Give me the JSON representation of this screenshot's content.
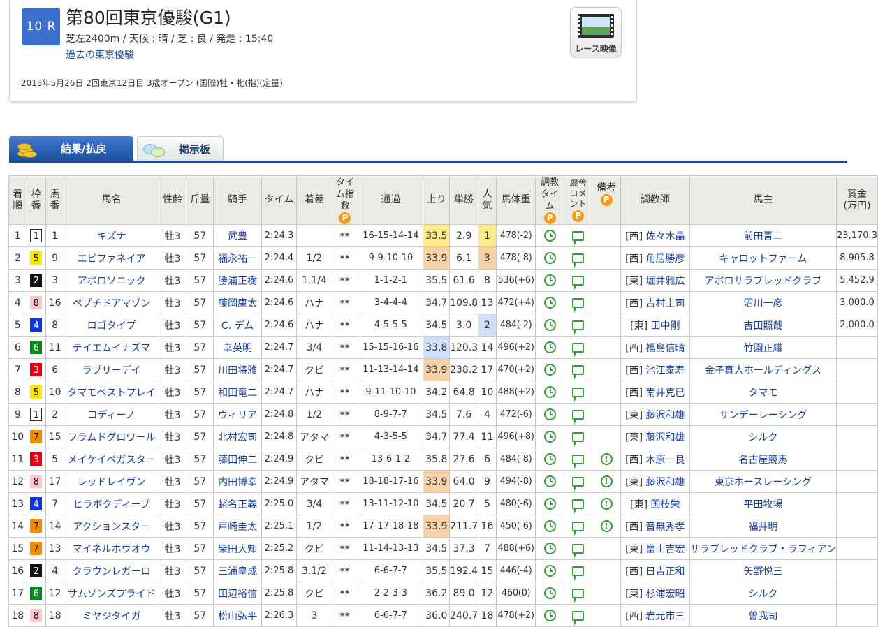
{
  "race": {
    "number": "10 R",
    "title": "第80回東京優駿(G1)",
    "info": "芝左2400m / 天候 : 晴 / 芝 : 良 / 発走 : 15:40",
    "past_link": "過去の東京優駿",
    "date_line": "2013年5月26日 2回東京12日目 3歳オープン (国際)牡・牝(指)(定量)",
    "video_label": "レース映像"
  },
  "tabs": {
    "results": "結果/払戻",
    "board": "掲示板"
  },
  "table": {
    "headers": {
      "rank": "着順",
      "waku": "枠番",
      "umaban": "馬番",
      "name": "馬名",
      "sexage": "性齢",
      "weight": "斤量",
      "jockey": "騎手",
      "time": "タイム",
      "margin": "着差",
      "timeindex": "タイム指数",
      "passage": "通過",
      "last3f": "上り",
      "odds": "単勝",
      "popularity": "人気",
      "bodyweight": "馬体重",
      "training": "調教タイム",
      "comment": "厩舎コメント",
      "note": "備考",
      "trainer": "調教師",
      "owner": "馬主",
      "prize": "賞金(万円)"
    },
    "premium_mark": "P",
    "rows": [
      {
        "rank": "1",
        "waku": "1",
        "umaban": "1",
        "name": "キズナ",
        "sexage": "牡3",
        "weight": "57",
        "jockey": "武豊",
        "time": "2:24.3",
        "margin": "",
        "idx": "**",
        "passage": "16-15-14-14",
        "last3f": "33.5",
        "last3f_hl": "y",
        "odds": "2.9",
        "pop": "1",
        "pop_hl": "y",
        "body": "478(-2)",
        "note": false,
        "trainer": "[西] 佐々木晶",
        "owner": "前田晋二",
        "prize": "23,170.3"
      },
      {
        "rank": "2",
        "waku": "5",
        "umaban": "9",
        "name": "エピファネイア",
        "sexage": "牡3",
        "weight": "57",
        "jockey": "福永祐一",
        "time": "2:24.4",
        "margin": "1/2",
        "idx": "**",
        "passage": "9-9-10-10",
        "last3f": "33.9",
        "last3f_hl": "o",
        "odds": "6.1",
        "pop": "3",
        "pop_hl": "o",
        "body": "478(-8)",
        "note": false,
        "trainer": "[西] 角居勝彦",
        "owner": "キャロットファーム",
        "prize": "8,905.8"
      },
      {
        "rank": "3",
        "waku": "2",
        "umaban": "3",
        "name": "アポロソニック",
        "sexage": "牡3",
        "weight": "57",
        "jockey": "勝浦正樹",
        "time": "2:24.6",
        "margin": "1.1/4",
        "idx": "**",
        "passage": "1-1-2-1",
        "last3f": "35.5",
        "last3f_hl": "",
        "odds": "61.6",
        "pop": "8",
        "pop_hl": "",
        "body": "536(+6)",
        "note": false,
        "trainer": "[東] 堀井雅広",
        "owner": "アポロサラブレッドクラブ",
        "prize": "5,452.9"
      },
      {
        "rank": "4",
        "waku": "8",
        "umaban": "16",
        "name": "ペプチドアマゾン",
        "sexage": "牡3",
        "weight": "57",
        "jockey": "藤岡康太",
        "time": "2:24.6",
        "margin": "ハナ",
        "idx": "**",
        "passage": "3-4-4-4",
        "last3f": "34.7",
        "last3f_hl": "",
        "odds": "109.8",
        "pop": "13",
        "pop_hl": "",
        "body": "472(+4)",
        "note": false,
        "trainer": "[西] 吉村圭司",
        "owner": "沼川一彦",
        "prize": "3,000.0"
      },
      {
        "rank": "5",
        "waku": "4",
        "umaban": "8",
        "name": "ロゴタイプ",
        "sexage": "牡3",
        "weight": "57",
        "jockey": "C. デム",
        "time": "2:24.6",
        "margin": "ハナ",
        "idx": "**",
        "passage": "4-5-5-5",
        "last3f": "34.5",
        "last3f_hl": "",
        "odds": "3.0",
        "pop": "2",
        "pop_hl": "b",
        "body": "484(-2)",
        "note": false,
        "trainer": "[東] 田中剛",
        "owner": "吉田照哉",
        "prize": "2,000.0"
      },
      {
        "rank": "6",
        "waku": "6",
        "umaban": "11",
        "name": "テイエムイナズマ",
        "sexage": "牡3",
        "weight": "57",
        "jockey": "幸英明",
        "time": "2:24.7",
        "margin": "3/4",
        "idx": "**",
        "passage": "15-15-16-16",
        "last3f": "33.8",
        "last3f_hl": "b",
        "odds": "120.3",
        "pop": "14",
        "pop_hl": "",
        "body": "496(+2)",
        "note": false,
        "trainer": "[西] 福島信晴",
        "owner": "竹園正繼",
        "prize": ""
      },
      {
        "rank": "7",
        "waku": "3",
        "umaban": "6",
        "name": "ラブリーデイ",
        "sexage": "牡3",
        "weight": "57",
        "jockey": "川田将雅",
        "time": "2:24.7",
        "margin": "クビ",
        "idx": "**",
        "passage": "11-13-14-14",
        "last3f": "33.9",
        "last3f_hl": "o",
        "odds": "238.2",
        "pop": "17",
        "pop_hl": "",
        "body": "470(+2)",
        "note": false,
        "trainer": "[西] 池江泰寿",
        "owner": "金子真人ホールディングス",
        "prize": ""
      },
      {
        "rank": "8",
        "waku": "5",
        "umaban": "10",
        "name": "タマモベストプレイ",
        "sexage": "牡3",
        "weight": "57",
        "jockey": "和田竜二",
        "time": "2:24.7",
        "margin": "ハナ",
        "idx": "**",
        "passage": "9-11-10-10",
        "last3f": "34.2",
        "last3f_hl": "",
        "odds": "64.8",
        "pop": "10",
        "pop_hl": "",
        "body": "488(+2)",
        "note": false,
        "trainer": "[西] 南井克巳",
        "owner": "タマモ",
        "prize": ""
      },
      {
        "rank": "9",
        "waku": "1",
        "umaban": "2",
        "name": "コディーノ",
        "sexage": "牡3",
        "weight": "57",
        "jockey": "ウィリア",
        "time": "2:24.8",
        "margin": "1/2",
        "idx": "**",
        "passage": "8-9-7-7",
        "last3f": "34.5",
        "last3f_hl": "",
        "odds": "7.6",
        "pop": "4",
        "pop_hl": "",
        "body": "472(-6)",
        "note": false,
        "trainer": "[東] 藤沢和雄",
        "owner": "サンデーレーシング",
        "prize": ""
      },
      {
        "rank": "10",
        "waku": "7",
        "umaban": "15",
        "name": "フラムドグロワール",
        "sexage": "牡3",
        "weight": "57",
        "jockey": "北村宏司",
        "time": "2:24.8",
        "margin": "アタマ",
        "idx": "**",
        "passage": "4-3-5-5",
        "last3f": "34.7",
        "last3f_hl": "",
        "odds": "77.4",
        "pop": "11",
        "pop_hl": "",
        "body": "496(+8)",
        "note": false,
        "trainer": "[東] 藤沢和雄",
        "owner": "シルク",
        "prize": ""
      },
      {
        "rank": "11",
        "waku": "3",
        "umaban": "5",
        "name": "メイケイペガスター",
        "sexage": "牡3",
        "weight": "57",
        "jockey": "藤田伸二",
        "time": "2:24.9",
        "margin": "クビ",
        "idx": "**",
        "passage": "13-6-1-2",
        "last3f": "35.8",
        "last3f_hl": "",
        "odds": "27.6",
        "pop": "6",
        "pop_hl": "",
        "body": "484(-8)",
        "note": true,
        "trainer": "[西] 木原一良",
        "owner": "名古屋競馬",
        "prize": ""
      },
      {
        "rank": "12",
        "waku": "8",
        "umaban": "17",
        "name": "レッドレイヴン",
        "sexage": "牡3",
        "weight": "57",
        "jockey": "内田博幸",
        "time": "2:24.9",
        "margin": "アタマ",
        "idx": "**",
        "passage": "18-18-17-16",
        "last3f": "33.9",
        "last3f_hl": "o",
        "odds": "64.0",
        "pop": "9",
        "pop_hl": "",
        "body": "494(-8)",
        "note": true,
        "trainer": "[東] 藤沢和雄",
        "owner": "東京ホースレーシング",
        "prize": ""
      },
      {
        "rank": "13",
        "waku": "4",
        "umaban": "7",
        "name": "ヒラボクディープ",
        "sexage": "牡3",
        "weight": "57",
        "jockey": "蛯名正義",
        "time": "2:25.0",
        "margin": "3/4",
        "idx": "**",
        "passage": "13-11-12-10",
        "last3f": "34.5",
        "last3f_hl": "",
        "odds": "20.7",
        "pop": "5",
        "pop_hl": "",
        "body": "480(-6)",
        "note": true,
        "trainer": "[東] 国枝栄",
        "owner": "平田牧場",
        "prize": ""
      },
      {
        "rank": "14",
        "waku": "7",
        "umaban": "14",
        "name": "アクションスター",
        "sexage": "牡3",
        "weight": "57",
        "jockey": "戸崎圭太",
        "time": "2:25.1",
        "margin": "1/2",
        "idx": "**",
        "passage": "17-17-18-18",
        "last3f": "33.9",
        "last3f_hl": "o",
        "odds": "211.7",
        "pop": "16",
        "pop_hl": "",
        "body": "450(-6)",
        "note": true,
        "trainer": "[西] 音無秀孝",
        "owner": "福井明",
        "prize": ""
      },
      {
        "rank": "15",
        "waku": "7",
        "umaban": "13",
        "name": "マイネルホウオウ",
        "sexage": "牡3",
        "weight": "57",
        "jockey": "柴田大知",
        "time": "2:25.2",
        "margin": "クビ",
        "idx": "**",
        "passage": "11-14-13-13",
        "last3f": "34.5",
        "last3f_hl": "",
        "odds": "37.3",
        "pop": "7",
        "pop_hl": "",
        "body": "488(+6)",
        "note": false,
        "trainer": "[東] 畠山吉宏",
        "owner": "サラブレッドクラブ・ラフィアン",
        "prize": ""
      },
      {
        "rank": "16",
        "waku": "2",
        "umaban": "4",
        "name": "クラウンレガーロ",
        "sexage": "牡3",
        "weight": "57",
        "jockey": "三浦皇成",
        "time": "2:25.8",
        "margin": "3.1/2",
        "idx": "**",
        "passage": "6-6-7-7",
        "last3f": "35.5",
        "last3f_hl": "",
        "odds": "192.4",
        "pop": "15",
        "pop_hl": "",
        "body": "446(-4)",
        "note": false,
        "trainer": "[西] 日吉正和",
        "owner": "矢野悦三",
        "prize": ""
      },
      {
        "rank": "17",
        "waku": "6",
        "umaban": "12",
        "name": "サムソンズプライド",
        "sexage": "牡3",
        "weight": "57",
        "jockey": "田辺裕信",
        "time": "2:25.8",
        "margin": "クビ",
        "idx": "**",
        "passage": "2-2-3-3",
        "last3f": "36.2",
        "last3f_hl": "",
        "odds": "89.0",
        "pop": "12",
        "pop_hl": "",
        "body": "460(0)",
        "note": false,
        "trainer": "[東] 杉浦宏昭",
        "owner": "シルク",
        "prize": ""
      },
      {
        "rank": "18",
        "waku": "8",
        "umaban": "18",
        "name": "ミヤジタイガ",
        "sexage": "牡3",
        "weight": "57",
        "jockey": "松山弘平",
        "time": "2:26.3",
        "margin": "3",
        "idx": "**",
        "passage": "6-6-7-7",
        "last3f": "36.0",
        "last3f_hl": "",
        "odds": "240.7",
        "pop": "18",
        "pop_hl": "",
        "body": "478(+2)",
        "note": false,
        "trainer": "[西] 岩元市三",
        "owner": "曽我司",
        "prize": ""
      }
    ]
  },
  "colors": {
    "waku": {
      "1": "#ffffff",
      "2": "#111111",
      "3": "#e60012",
      "4": "#1034d8",
      "5": "#f6e600",
      "6": "#0a8a1e",
      "7": "#f58b00",
      "8": "#fac4cf"
    },
    "waku_text": {
      "1": "#111111",
      "2": "#ffffff",
      "3": "#ffffff",
      "4": "#ffffff",
      "5": "#111111",
      "6": "#ffffff",
      "7": "#111111",
      "8": "#111111"
    },
    "accent": "#1f4b8e",
    "premium": "#f49b16",
    "icon_green": "#3a9a3a"
  },
  "icons": {
    "training": "clock-icon",
    "comment": "comment-icon",
    "note": "note-icon",
    "premium": "premium-p-icon",
    "video": "race-video-icon"
  }
}
